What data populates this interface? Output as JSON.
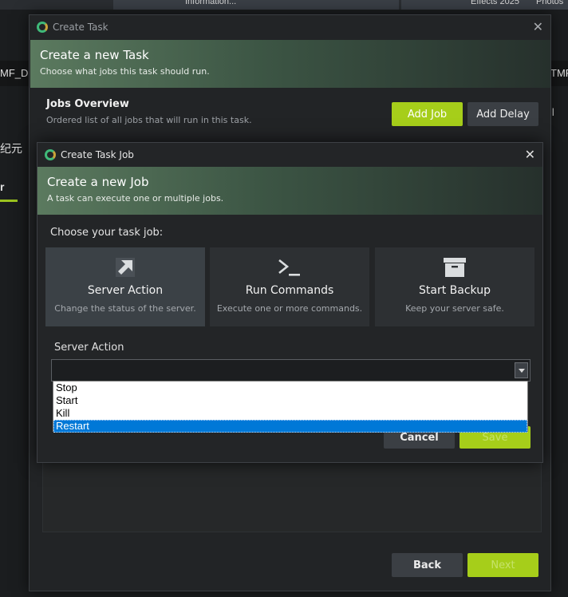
{
  "background": {
    "top_text_1": "Information...",
    "top_text_2": "Effects 2025",
    "top_text_3": "Photos",
    "left_text_1": "MF_D",
    "right_text_1": "TMF",
    "left_text_2": "纪元",
    "left_tab": "r",
    "right_glyph": "ll"
  },
  "outer_dialog": {
    "window_title": "Create Task",
    "heading": "Create a new Task",
    "subheading": "Choose what jobs this task should run.",
    "jobs_title": "Jobs Overview",
    "jobs_subtitle": "Ordered list of all jobs that will run in this task.",
    "add_job_label": "Add Job",
    "add_delay_label": "Add Delay",
    "back_label": "Back",
    "next_label": "Next"
  },
  "inner_dialog": {
    "window_title": "Create Task Job",
    "heading": "Create a new Job",
    "subheading": "A task can execute one or multiple jobs.",
    "choose_label": "Choose your task job:",
    "cards": [
      {
        "title": "Server Action",
        "desc": "Change the status of the server.",
        "icon": "arrow-up-right-icon"
      },
      {
        "title": "Run Commands",
        "desc": "Execute one or more commands.",
        "icon": "terminal-icon"
      },
      {
        "title": "Start Backup",
        "desc": "Keep your server safe.",
        "icon": "archive-box-icon"
      }
    ],
    "field_label": "Server Action",
    "select_value": "",
    "options": [
      "Stop",
      "Start",
      "Kill",
      "Restart"
    ],
    "highlighted_option": "Restart",
    "cancel_label": "Cancel",
    "save_label": "Save"
  },
  "colors": {
    "accent_green": "#a6ce1a",
    "selection_blue": "#0078d7"
  }
}
